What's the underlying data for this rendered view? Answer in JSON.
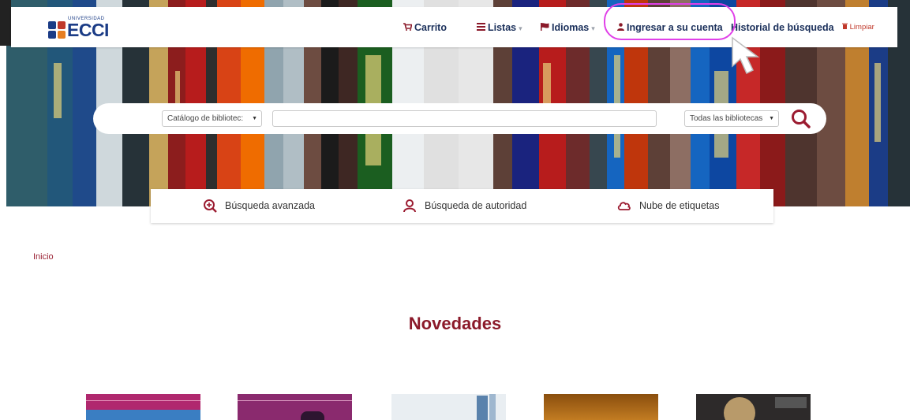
{
  "navbar": {
    "logo_small": "UNIVERSIDAD",
    "logo_word": "ECCI",
    "logo_colors": [
      "#1b3c86",
      "#c0392b",
      "#1b3c86",
      "#e67e22"
    ],
    "items": [
      {
        "label": "Carrito",
        "icon": "cart-icon"
      },
      {
        "label": "Listas",
        "icon": "list-icon"
      },
      {
        "label": "Idiomas",
        "icon": "flag-icon"
      },
      {
        "label": "Ingresar a su cuenta",
        "icon": "user-icon"
      },
      {
        "label": "Historial de búsqueda"
      }
    ],
    "clear_label": "Limpiar",
    "clear_icon": "trash-icon"
  },
  "search": {
    "catalog_select": "Catálogo de bibliotec:",
    "query_value": "",
    "library_select": "Todas las bibliotecas",
    "button_icon": "search-icon"
  },
  "subnav": [
    {
      "label": "Búsqueda avanzada",
      "icon": "advanced-search-icon"
    },
    {
      "label": "Búsqueda de autoridad",
      "icon": "authority-icon"
    },
    {
      "label": "Nube de etiquetas",
      "icon": "tag-cloud-icon"
    }
  ],
  "breadcrumb": {
    "home": "Inicio"
  },
  "section": {
    "title": "Novedades"
  },
  "colors": {
    "brand": "#1b3c86",
    "accent": "#8b1a2a",
    "highlight": "#e040e8"
  }
}
